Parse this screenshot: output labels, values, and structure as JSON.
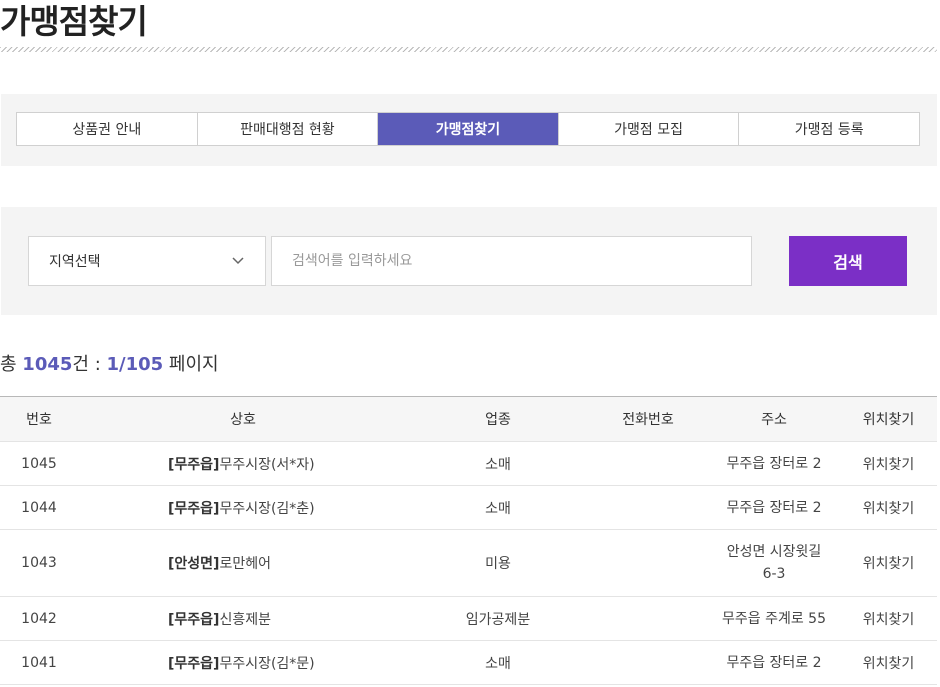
{
  "page": {
    "title": "가맹점찾기"
  },
  "tabs": [
    {
      "label": "상품권 안내",
      "active": false
    },
    {
      "label": "판매대행점 현황",
      "active": false
    },
    {
      "label": "가맹점찾기",
      "active": true
    },
    {
      "label": "가맹점 모집",
      "active": false
    },
    {
      "label": "가맹점 등록",
      "active": false
    }
  ],
  "search": {
    "region_select": "지역선택",
    "placeholder": "검색어를 입력하세요",
    "button_label": "검색"
  },
  "summary": {
    "prefix": "총 ",
    "total": "1045",
    "unit": "건 : ",
    "page": "1/105",
    "suffix": " 페이지"
  },
  "table": {
    "headers": [
      "번호",
      "상호",
      "업종",
      "전화번호",
      "주소",
      "위치찾기"
    ],
    "rows": [
      {
        "no": "1045",
        "region": "[무주읍]",
        "name": "무주시장(서*자)",
        "category": "소매",
        "phone": "",
        "address": "무주읍 장터로 2",
        "locate": "위치찾기"
      },
      {
        "no": "1044",
        "region": "[무주읍]",
        "name": "무주시장(김*춘)",
        "category": "소매",
        "phone": "",
        "address": "무주읍 장터로 2",
        "locate": "위치찾기"
      },
      {
        "no": "1043",
        "region": "[안성면]",
        "name": "로만헤어",
        "category": "미용",
        "phone": "",
        "address": "안성면 시장윗길\n6-3",
        "locate": "위치찾기"
      },
      {
        "no": "1042",
        "region": "[무주읍]",
        "name": "신흥제분",
        "category": "임가공제분",
        "phone": "",
        "address": "무주읍 주계로 55",
        "locate": "위치찾기"
      },
      {
        "no": "1041",
        "region": "[무주읍]",
        "name": "무주시장(김*문)",
        "category": "소매",
        "phone": "",
        "address": "무주읍 장터로 2",
        "locate": "위치찾기"
      }
    ]
  }
}
